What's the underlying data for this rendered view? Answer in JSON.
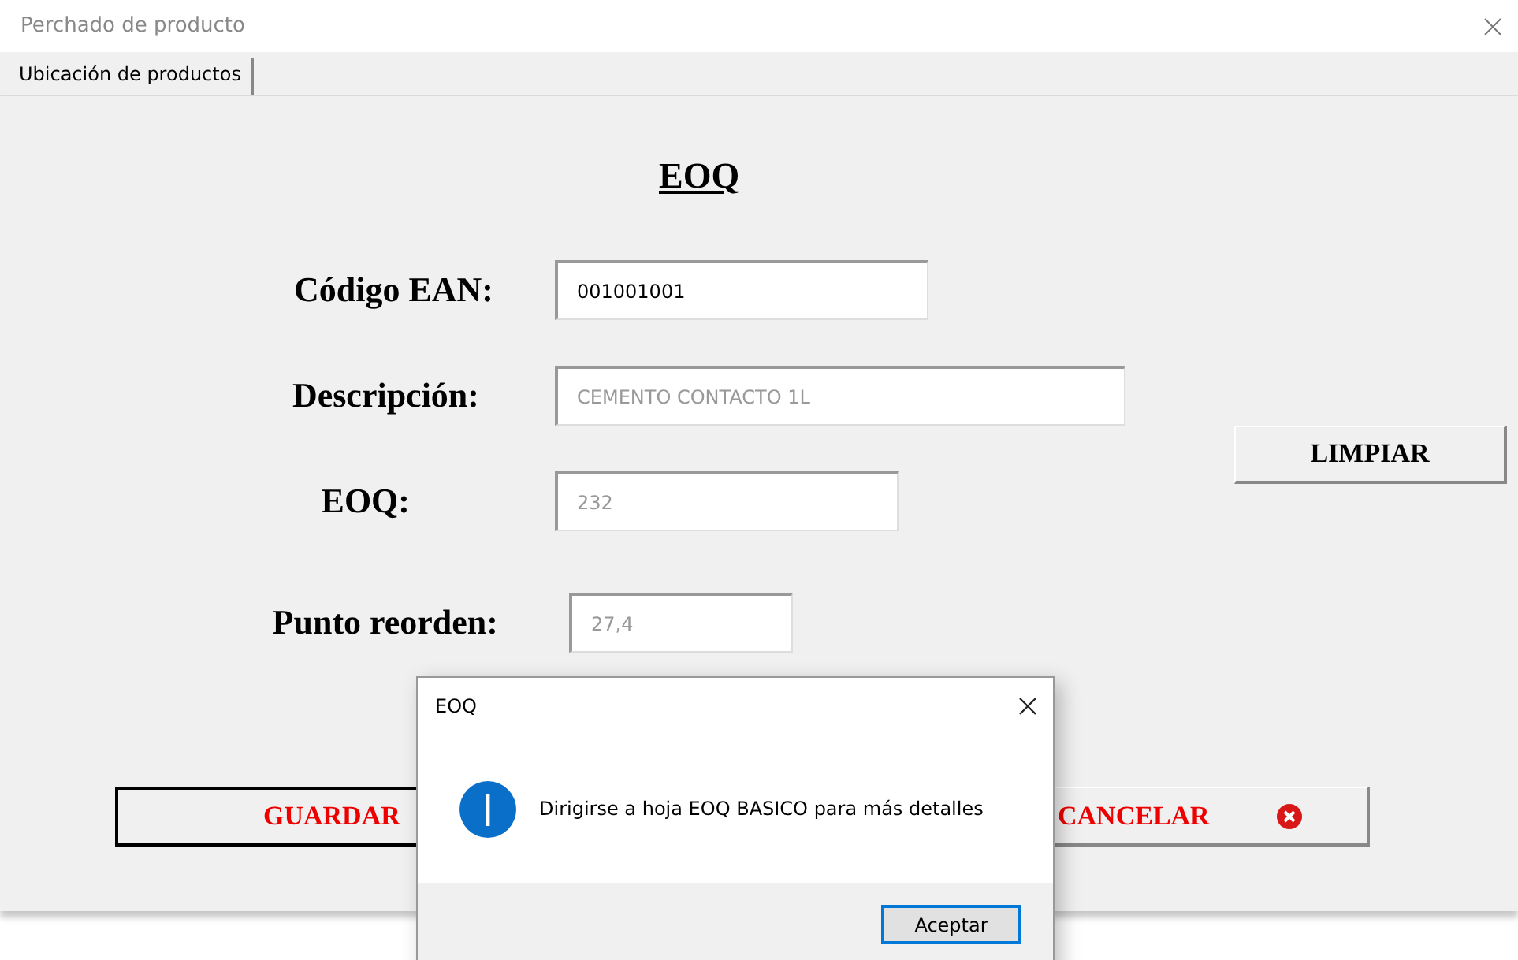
{
  "window": {
    "title": "Perchado de producto"
  },
  "tabs": [
    {
      "label": "Ubicación de productos",
      "selected": true
    }
  ],
  "form": {
    "heading": "EOQ",
    "fields": [
      {
        "label": "Código EAN:",
        "value": "001001001",
        "disabled": false
      },
      {
        "label": "Descripción:",
        "value": "CEMENTO CONTACTO 1L",
        "disabled": true
      },
      {
        "label": "EOQ:",
        "value": "232",
        "disabled": true
      },
      {
        "label": "Punto reorden:",
        "value": "27,4",
        "disabled": true
      }
    ],
    "clear_button": "LIMPIAR",
    "save_button": "GUARDAR",
    "cancel_button": "CANCELAR"
  },
  "dialog": {
    "title": "EOQ",
    "message": "Dirigirse a hoja EOQ BASICO para más detalles",
    "button": "Aceptar"
  }
}
